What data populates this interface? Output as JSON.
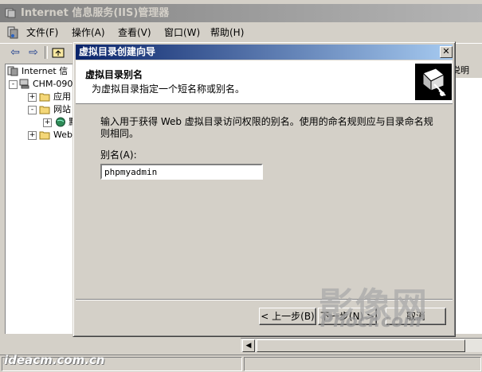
{
  "main_window": {
    "title": "Internet 信息服务(IIS)管理器"
  },
  "menu": [
    "文件(F)",
    "操作(A)",
    "查看(V)",
    "窗口(W)",
    "帮助(H)"
  ],
  "toolbar_icons": [
    "back-arrow-icon",
    "forward-arrow-icon",
    "up-folder-icon"
  ],
  "tree": {
    "items": [
      {
        "label": "Internet 信",
        "indent": 0,
        "expander": "",
        "icon": "iis-icon"
      },
      {
        "label": "CHM-090",
        "indent": 1,
        "expander": "-",
        "icon": "computer-icon"
      },
      {
        "label": "应用",
        "indent": 2,
        "expander": "+",
        "icon": "folder-icon"
      },
      {
        "label": "网站",
        "indent": 2,
        "expander": "-",
        "icon": "folder-icon"
      },
      {
        "label": "默",
        "indent": 3,
        "expander": "+",
        "icon": "globe-icon"
      },
      {
        "label": "Web",
        "indent": 2,
        "expander": "+",
        "icon": "folder-icon"
      }
    ]
  },
  "right_pane": {
    "column_header": "说明"
  },
  "wizard": {
    "title": "虚拟目录创建向导",
    "header_title": "虚拟目录别名",
    "header_subtitle": "为虚拟目录指定一个短名称或别名。",
    "description": "输入用于获得 Web 虚拟目录访问权限的别名。使用的命名规则应与目录命名规则相同。",
    "alias_label": "别名(A):",
    "alias_value": "phpmyadmin",
    "buttons": {
      "back": "< 上一步(B)",
      "next": "下一步(N) >",
      "cancel": "取消"
    },
    "colors": {
      "title_start": "#0a246a",
      "title_end": "#a6caf0"
    }
  },
  "watermarks": {
    "logo_cn": "影像网",
    "logo_en": "Phocr.com",
    "url": "ideacm.com.cn"
  }
}
